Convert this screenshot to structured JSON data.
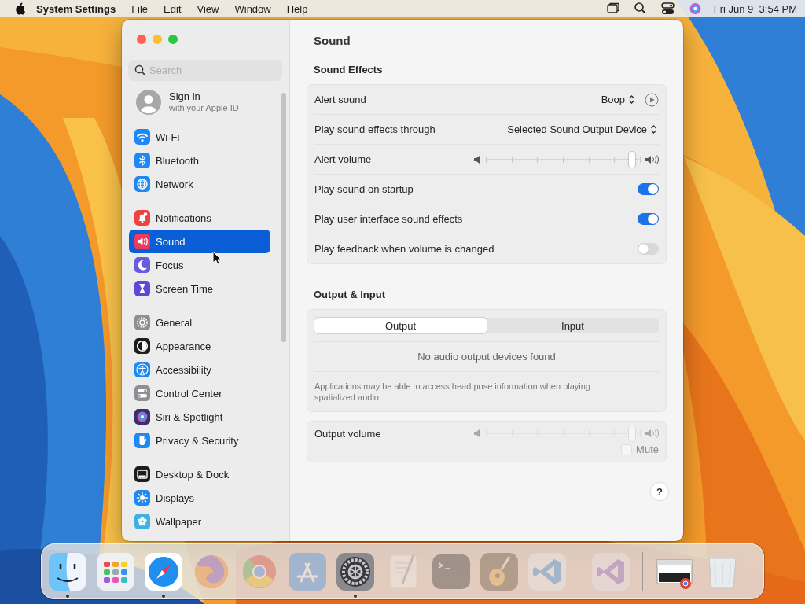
{
  "menu_bar": {
    "app_name": "System Settings",
    "menus": [
      "File",
      "Edit",
      "View",
      "Window",
      "Help"
    ],
    "clock": "Fri Jun 9  3:54 PM"
  },
  "sidebar": {
    "search": {
      "placeholder": "Search"
    },
    "account": {
      "title": "Sign in",
      "subtitle": "with your Apple ID"
    },
    "groups": [
      [
        {
          "label": "Wi-Fi",
          "selected": false,
          "color": "#1e88f5"
        },
        {
          "label": "Bluetooth",
          "selected": false,
          "color": "#1e88f5"
        },
        {
          "label": "Network",
          "selected": false,
          "color": "#1e88f5"
        }
      ],
      [
        {
          "label": "Notifications",
          "selected": false,
          "color": "#ee4343"
        },
        {
          "label": "Sound",
          "selected": true,
          "color": "#ef3a5d"
        },
        {
          "label": "Focus",
          "selected": false,
          "color": "#6a5ae0"
        },
        {
          "label": "Screen Time",
          "selected": false,
          "color": "#6247d6"
        }
      ],
      [
        {
          "label": "General",
          "selected": false,
          "color": "#8e8e93"
        },
        {
          "label": "Appearance",
          "selected": false,
          "color": "#1c1c1e"
        },
        {
          "label": "Accessibility",
          "selected": false,
          "color": "#1e88f5"
        },
        {
          "label": "Control Center",
          "selected": false,
          "color": "#8e8e93"
        },
        {
          "label": "Siri & Spotlight",
          "selected": false,
          "color": "#3a2f6b"
        },
        {
          "label": "Privacy & Security",
          "selected": false,
          "color": "#1e88f5"
        }
      ],
      [
        {
          "label": "Desktop & Dock",
          "selected": false,
          "color": "#1c1c1e"
        },
        {
          "label": "Displays",
          "selected": false,
          "color": "#1e88f5"
        },
        {
          "label": "Wallpaper",
          "selected": false,
          "color": "#3fb0e0"
        }
      ]
    ]
  },
  "main": {
    "title": "Sound",
    "sound_effects": {
      "heading": "Sound Effects",
      "rows": [
        {
          "kind": "popup",
          "label": "Alert sound",
          "value": "Boop",
          "play_button": true
        },
        {
          "kind": "popup",
          "label": "Play sound effects through",
          "value": "Selected Sound Output Device",
          "play_button": false
        },
        {
          "kind": "slider",
          "label": "Alert volume",
          "level": 0.95
        },
        {
          "kind": "toggle",
          "label": "Play sound on startup",
          "on": true
        },
        {
          "kind": "toggle",
          "label": "Play user interface sound effects",
          "on": true
        },
        {
          "kind": "toggle",
          "label": "Play feedback when volume is changed",
          "on": false
        }
      ]
    },
    "output_input": {
      "heading": "Output & Input",
      "segments": [
        {
          "label": "Output",
          "selected": true
        },
        {
          "label": "Input",
          "selected": false
        }
      ],
      "message": "No audio output devices found",
      "note": "Applications may be able to access head pose information when playing spatialized audio."
    },
    "output_volume": {
      "label": "Output volume",
      "level": 0.95,
      "disabled": true,
      "mute": {
        "label": "Mute",
        "checked": false
      }
    },
    "help_button": "?"
  },
  "dock": {
    "items": [
      {
        "kind": "app",
        "running": true,
        "dimmed": false
      },
      {
        "kind": "app",
        "running": false,
        "dimmed": false
      },
      {
        "kind": "app",
        "running": true,
        "dimmed": false
      },
      {
        "kind": "app",
        "running": false,
        "dimmed": true
      },
      {
        "kind": "app",
        "running": false,
        "dimmed": true
      },
      {
        "kind": "app",
        "running": false,
        "dimmed": true
      },
      {
        "kind": "app",
        "running": true,
        "dimmed": false
      },
      {
        "kind": "app",
        "running": false,
        "dimmed": true
      },
      {
        "kind": "app",
        "running": false,
        "dimmed": true
      },
      {
        "kind": "app",
        "running": false,
        "dimmed": true
      },
      {
        "kind": "app",
        "running": false,
        "dimmed": true
      },
      {
        "kind": "separator"
      },
      {
        "kind": "app",
        "running": false,
        "dimmed": true
      },
      {
        "kind": "separator"
      },
      {
        "kind": "app",
        "running": false,
        "dimmed": false
      },
      {
        "kind": "app",
        "running": false,
        "dimmed": false
      }
    ]
  }
}
